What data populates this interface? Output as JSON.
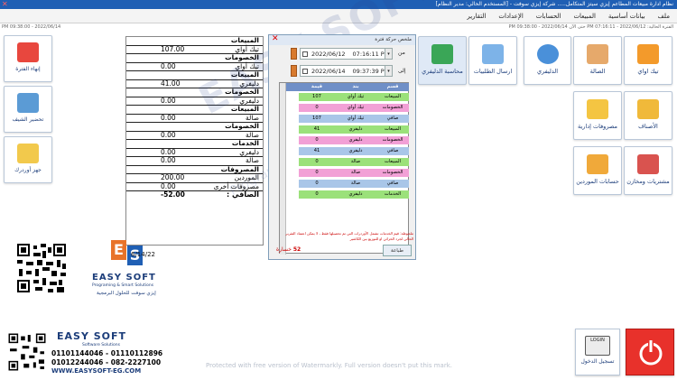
{
  "window": {
    "title": "نظام ادارة مبيعات المطاعم إيزي سيتز المتكامل..... شركة إيزي سوفت - [المستخدم الحالي: مدير النظام]",
    "close_glyph": "✕"
  },
  "menu": {
    "items": [
      "ملف",
      "بيانات أساسية",
      "المبيعات",
      "الحسابات",
      "الإعدادات",
      "التقارير"
    ]
  },
  "status": {
    "right": "الفترة الحالية: 2022/06/12 - 07:16:11 PM حتى الآن 2022/06/14 - 09:38:00 PM",
    "left": "PM 09:38:00 - 2022/06/14"
  },
  "tiles": {
    "takeaway": "تيك اواي",
    "hall": "الصالة",
    "delivery": "الدليفري",
    "send_orders": "ارسال الطلبيات",
    "delivery_accounting": "محاسبة الدليفري",
    "items": "الأصناف",
    "admin_expenses": "مصروفات إدارية",
    "purchases_stores": "مشتريات ومخازن",
    "supplier_accounts": "حسابات الموردين"
  },
  "side": {
    "end_period": "إنهاء الفترة",
    "chef_prep": "تحضير الشيف",
    "order_device": "جهز أوردرك"
  },
  "report": {
    "rows": [
      {
        "label": "المبيعات",
        "value": "",
        "type": "hdr"
      },
      {
        "label": "تيك أواي",
        "value": "107.00",
        "type": "row"
      },
      {
        "label": "الخصومات",
        "value": "",
        "type": "hdr"
      },
      {
        "label": "تيك أواي",
        "value": "0.00",
        "type": "row"
      },
      {
        "label": "المبيعات",
        "value": "",
        "type": "hdr"
      },
      {
        "label": "دليفري",
        "value": "41.00",
        "type": "row"
      },
      {
        "label": "الخصومات",
        "value": "",
        "type": "hdr"
      },
      {
        "label": "دليفري",
        "value": "0.00",
        "type": "row"
      },
      {
        "label": "المبيعات",
        "value": "",
        "type": "hdr"
      },
      {
        "label": "صالة",
        "value": "0.00",
        "type": "row"
      },
      {
        "label": "الخصومات",
        "value": "",
        "type": "hdr"
      },
      {
        "label": "صالة",
        "value": "0.00",
        "type": "row"
      },
      {
        "label": "الخدمات",
        "value": "",
        "type": "hdr"
      },
      {
        "label": "دليفري",
        "value": "0.00",
        "type": "row"
      },
      {
        "label": "صالة",
        "value": "0.00",
        "type": "row"
      },
      {
        "label": "المصروفات",
        "value": "",
        "type": "hdr"
      },
      {
        "label": "الموردين",
        "value": "200.00",
        "type": "row"
      },
      {
        "label": "مصروفات أخرى",
        "value": "0.00",
        "type": "row"
      },
      {
        "label": "الصافي :",
        "value": "-52.00",
        "type": "net"
      }
    ]
  },
  "dialog": {
    "title": "ملخص حركة فترة",
    "from_label": "من",
    "to_label": "إلى",
    "from_date": "2022/06/12",
    "from_time": "07:16:11 PM",
    "to_date": "2022/06/14",
    "to_time": "09:37:39 PM",
    "grid": {
      "headers": {
        "category": "قسم",
        "branch": "بند",
        "value": "قيمة"
      },
      "rows": [
        {
          "category": "المبيعات",
          "branch": "تيك أواي",
          "value": "107",
          "bg": "#9be17a"
        },
        {
          "category": "الخصومات",
          "branch": "تيك أواي",
          "value": "0",
          "bg": "#f2a0d6"
        },
        {
          "category": "صافي",
          "branch": "تيك أواي",
          "value": "107",
          "bg": "#a9c6e8"
        },
        {
          "category": "المبيعات",
          "branch": "دليفري",
          "value": "41",
          "bg": "#9be17a"
        },
        {
          "category": "الخصومات",
          "branch": "دليفري",
          "value": "0",
          "bg": "#f2a0d6"
        },
        {
          "category": "صافي",
          "branch": "دليفري",
          "value": "41",
          "bg": "#a9c6e8"
        },
        {
          "category": "المبيعات",
          "branch": "صالة",
          "value": "0",
          "bg": "#9be17a"
        },
        {
          "category": "الخصومات",
          "branch": "صالة",
          "value": "0",
          "bg": "#f2a0d6"
        },
        {
          "category": "صافي",
          "branch": "صالة",
          "value": "0",
          "bg": "#a9c6e8"
        },
        {
          "category": "الخدمات",
          "branch": "دليفري",
          "value": "0",
          "bg": "#9be17a"
        }
      ]
    },
    "note": "ملحوظة: قيم الخدمات تشمل الأوردرات التي تم تحصيلها فقط ، لا يمكن اعتماد التقرير الحالي لجرد الخزائن او للتوزيع بين الكاشير",
    "loss_label": "خسارة",
    "loss_value": "52",
    "print_button": "طباعة"
  },
  "branding": {
    "es_e": "E",
    "es_s": "S",
    "es_name": "EASY SOFT",
    "es_tagline": "Programing & Smart Solutions",
    "es_arabic": "إيزي سوفت للحلول البرمجية",
    "date_fragment": "6/14/22",
    "footer_name": "EASY SOFT",
    "footer_sub": "Software Solutions",
    "phone1": "01101144046 - 01110112896",
    "phone2": "01012244046 - 082-2227100",
    "website": "WWW.EASYSOFT-EG.COM"
  },
  "watermark": {
    "main": "EASY SOFT",
    "sub": "Programing & Smart Solutions",
    "footer": "Protected with free version of Watermarkly. Full version doesn't put this mark."
  },
  "login": {
    "label": "تسجيل الدخول",
    "screen_text": "LOGIN"
  },
  "colors": {
    "accent": "#1f5fb4",
    "power": "#e8312b",
    "es_orange": "#e8732a",
    "es_blue": "#1f5fb4"
  }
}
